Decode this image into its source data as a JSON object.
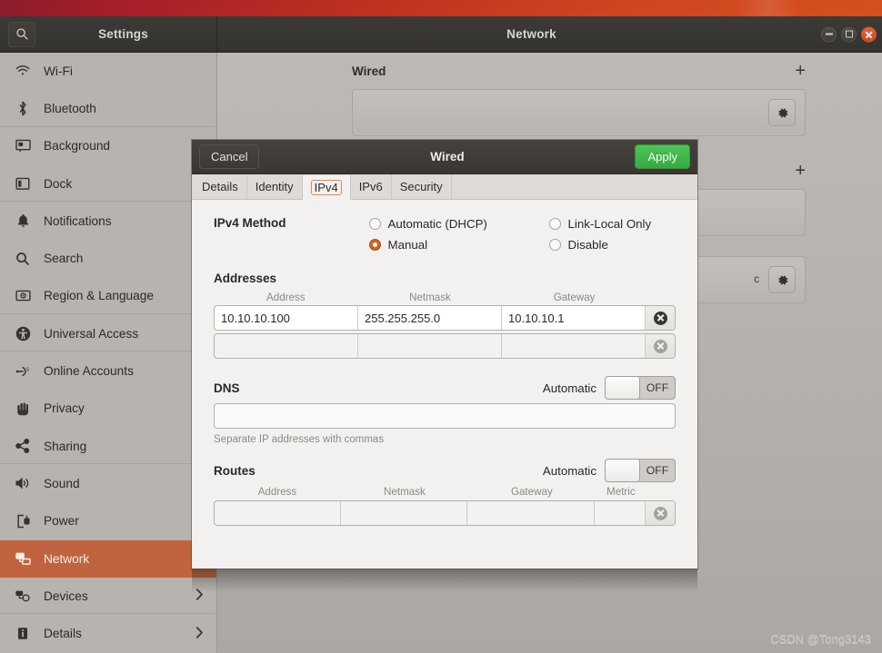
{
  "titlebar": {
    "search_icon": "search-icon",
    "left_title": "Settings",
    "right_title": "Network",
    "minimize_icon": "minimize-icon",
    "maximize_icon": "maximize-icon",
    "close_icon": "close-icon"
  },
  "sidebar": {
    "items": [
      {
        "label": "Wi-Fi",
        "icon": "wifi-icon",
        "active": false,
        "chevron": false
      },
      {
        "label": "Bluetooth",
        "icon": "bluetooth-icon",
        "active": false,
        "chevron": false
      },
      {
        "label": "Background",
        "icon": "background-icon",
        "active": false,
        "chevron": false
      },
      {
        "label": "Dock",
        "icon": "dock-icon",
        "active": false,
        "chevron": false
      },
      {
        "label": "Notifications",
        "icon": "bell-icon",
        "active": false,
        "chevron": false
      },
      {
        "label": "Search",
        "icon": "search-icon",
        "active": false,
        "chevron": false
      },
      {
        "label": "Region & Language",
        "icon": "region-language-icon",
        "active": false,
        "chevron": false
      },
      {
        "label": "Universal Access",
        "icon": "accessibility-icon",
        "active": false,
        "chevron": false
      },
      {
        "label": "Online Accounts",
        "icon": "online-accounts-icon",
        "active": false,
        "chevron": false
      },
      {
        "label": "Privacy",
        "icon": "hand-icon",
        "active": false,
        "chevron": false
      },
      {
        "label": "Sharing",
        "icon": "share-icon",
        "active": false,
        "chevron": false
      },
      {
        "label": "Sound",
        "icon": "speaker-icon",
        "active": false,
        "chevron": false
      },
      {
        "label": "Power",
        "icon": "power-plug-icon",
        "active": false,
        "chevron": false
      },
      {
        "label": "Network",
        "icon": "network-icon",
        "active": true,
        "chevron": false
      },
      {
        "label": "Devices",
        "icon": "devices-icon",
        "active": false,
        "chevron": true
      },
      {
        "label": "Details",
        "icon": "info-icon",
        "active": false,
        "chevron": true
      }
    ]
  },
  "content": {
    "wired_section_title": "Wired",
    "add_icon": "plus-icon",
    "gear_icon": "gear-icon",
    "card_note": "c"
  },
  "dialog": {
    "cancel_label": "Cancel",
    "title": "Wired",
    "apply_label": "Apply",
    "tabs": [
      {
        "label": "Details",
        "active": false
      },
      {
        "label": "Identity",
        "active": false
      },
      {
        "label": "IPv4",
        "active": true
      },
      {
        "label": "IPv6",
        "active": false
      },
      {
        "label": "Security",
        "active": false
      }
    ],
    "method": {
      "label": "IPv4 Method",
      "options": [
        {
          "label": "Automatic (DHCP)",
          "selected": false
        },
        {
          "label": "Link-Local Only",
          "selected": false
        },
        {
          "label": "Manual",
          "selected": true
        },
        {
          "label": "Disable",
          "selected": false
        }
      ]
    },
    "addresses": {
      "title": "Addresses",
      "columns": [
        "Address",
        "Netmask",
        "Gateway"
      ],
      "rows": [
        {
          "address": "10.10.10.100",
          "netmask": "255.255.255.0",
          "gateway": "10.10.10.1",
          "filled": true
        },
        {
          "address": "",
          "netmask": "",
          "gateway": "",
          "filled": false
        }
      ],
      "delete_icon": "delete-row-icon"
    },
    "dns": {
      "title": "DNS",
      "automatic_label": "Automatic",
      "toggle_state": "OFF",
      "value": "",
      "hint": "Separate IP addresses with commas"
    },
    "routes": {
      "title": "Routes",
      "automatic_label": "Automatic",
      "toggle_state": "OFF",
      "columns": [
        "Address",
        "Netmask",
        "Gateway",
        "Metric"
      ],
      "rows": [
        {
          "address": "",
          "netmask": "",
          "gateway": "",
          "metric": "",
          "filled": false
        }
      ],
      "delete_icon": "delete-row-icon"
    }
  },
  "watermark": "CSDN @Tong3143",
  "colors": {
    "accent_orange": "#d2601f",
    "sidebar_active": "#c0633f",
    "apply_green": "#36ab40",
    "close_red": "#cf4a25",
    "titlebar_dark": "#3a3733",
    "dialog_bg": "#f2f1ef"
  }
}
